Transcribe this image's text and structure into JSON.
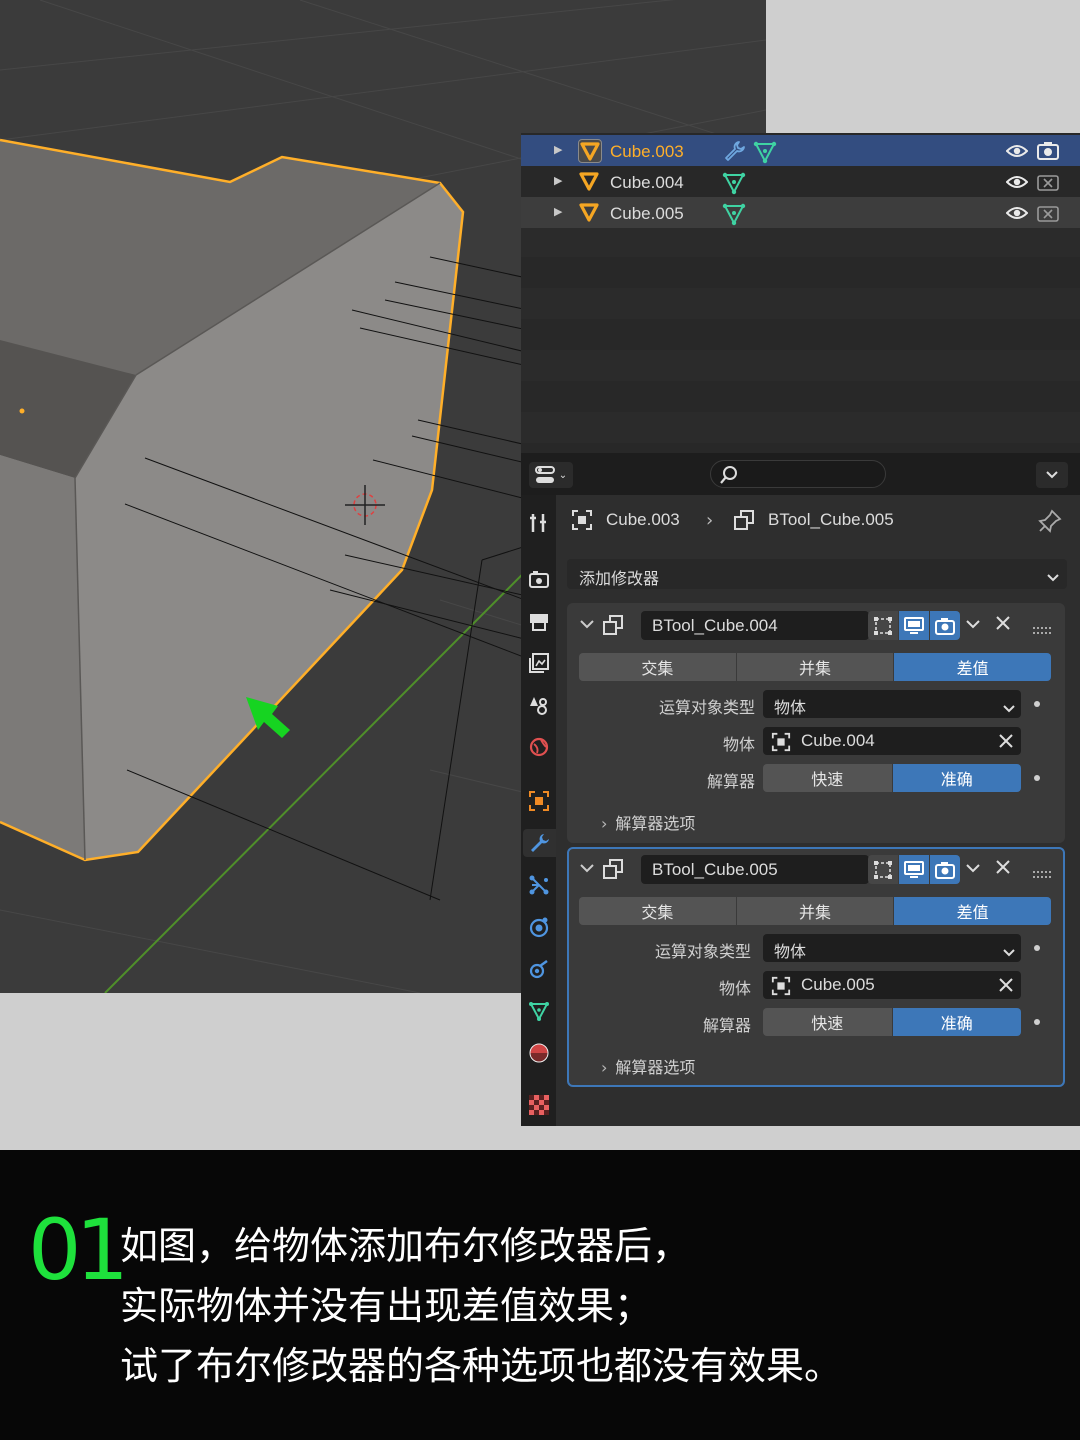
{
  "colors": {
    "accent_blue": "#3d77b8",
    "selection_orange": "#ffaf29",
    "caption_green": "#1ee13c",
    "mesh_green": "#3fd3a3"
  },
  "outliner": {
    "rows": [
      {
        "name": "Cube.003",
        "active": true,
        "has_modifier": true,
        "visible_icon": "eye-icon",
        "render_icon": "camera-icon"
      },
      {
        "name": "Cube.004",
        "active": false,
        "has_modifier": false,
        "visible_icon": "eye-icon",
        "render_icon": "camera-disabled-icon"
      },
      {
        "name": "Cube.005",
        "active": false,
        "has_modifier": false,
        "visible_icon": "eye-icon",
        "render_icon": "camera-disabled-icon"
      }
    ]
  },
  "properties": {
    "breadcrumb": {
      "object": "Cube.003",
      "modifier": "BTool_Cube.005"
    },
    "add_modifier_label": "添加修改器",
    "modifiers": [
      {
        "name": "BTool_Cube.004",
        "operations": [
          "交集",
          "并集",
          "差值"
        ],
        "active_operation": "差值",
        "operand_type_label": "运算对象类型",
        "operand_type_value": "物体",
        "object_label": "物体",
        "object_value": "Cube.004",
        "solver_label": "解算器",
        "solver_options": [
          "快速",
          "准确"
        ],
        "active_solver": "准确",
        "solver_options_panel": "解算器选项"
      },
      {
        "name": "BTool_Cube.005",
        "operations": [
          "交集",
          "并集",
          "差值"
        ],
        "active_operation": "差值",
        "operand_type_label": "运算对象类型",
        "operand_type_value": "物体",
        "object_label": "物体",
        "object_value": "Cube.005",
        "solver_label": "解算器",
        "solver_options": [
          "快速",
          "准确"
        ],
        "active_solver": "准确",
        "solver_options_panel": "解算器选项"
      }
    ]
  },
  "caption": {
    "number": "01",
    "lines": [
      "如图，给物体添加布尔修改器后，",
      "实际物体并没有出现差值效果；",
      "试了布尔修改器的各种选项也都没有效果。"
    ]
  }
}
